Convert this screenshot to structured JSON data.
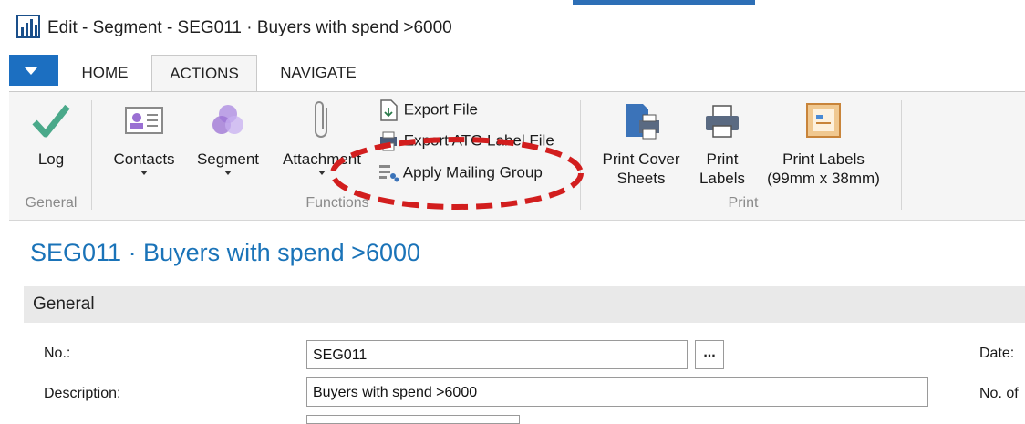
{
  "window": {
    "title": "Edit - Segment - SEG011 · Buyers with spend >6000",
    "accent_color": "#1c6fc1"
  },
  "tabs": [
    {
      "label": "HOME",
      "selected": false
    },
    {
      "label": "ACTIONS",
      "selected": true
    },
    {
      "label": "NAVIGATE",
      "selected": false
    }
  ],
  "ribbon": {
    "general": {
      "group_label": "General",
      "log": {
        "label": "Log",
        "icon": "checkmark-icon"
      }
    },
    "functions": {
      "group_label": "Functions",
      "contacts": {
        "label": "Contacts",
        "icon": "contact-card-icon"
      },
      "segment": {
        "label": "Segment",
        "icon": "segment-circles-icon"
      },
      "attachment": {
        "label": "Attachment",
        "icon": "paperclip-icon"
      },
      "export_file": {
        "label": "Export File",
        "icon": "export-file-icon"
      },
      "export_atg_label_file": {
        "label": "Export ATG Label File",
        "icon": "printer-file-icon"
      },
      "apply_mailing_group": {
        "label": "Apply Mailing Group",
        "icon": "mailing-group-icon"
      }
    },
    "print": {
      "group_label": "Print",
      "print_cover_sheets": {
        "label_line1": "Print Cover",
        "label_line2": "Sheets",
        "icon": "print-cover-icon"
      },
      "print_labels": {
        "label_line1": "Print",
        "label_line2": "Labels",
        "icon": "printer-icon"
      },
      "print_labels_99": {
        "label_line1": "Print Labels",
        "label_line2": "(99mm x 38mm)",
        "icon": "label-icon"
      }
    }
  },
  "page": {
    "title": "SEG011 · Buyers with spend >6000",
    "section": "General",
    "fields": {
      "no": {
        "label": "No.:",
        "value": "SEG011",
        "lookup": "..."
      },
      "description": {
        "label": "Description:",
        "value": "Buyers with spend >6000"
      }
    },
    "right_labels": {
      "date": "Date:",
      "no_of": "No. of"
    }
  }
}
